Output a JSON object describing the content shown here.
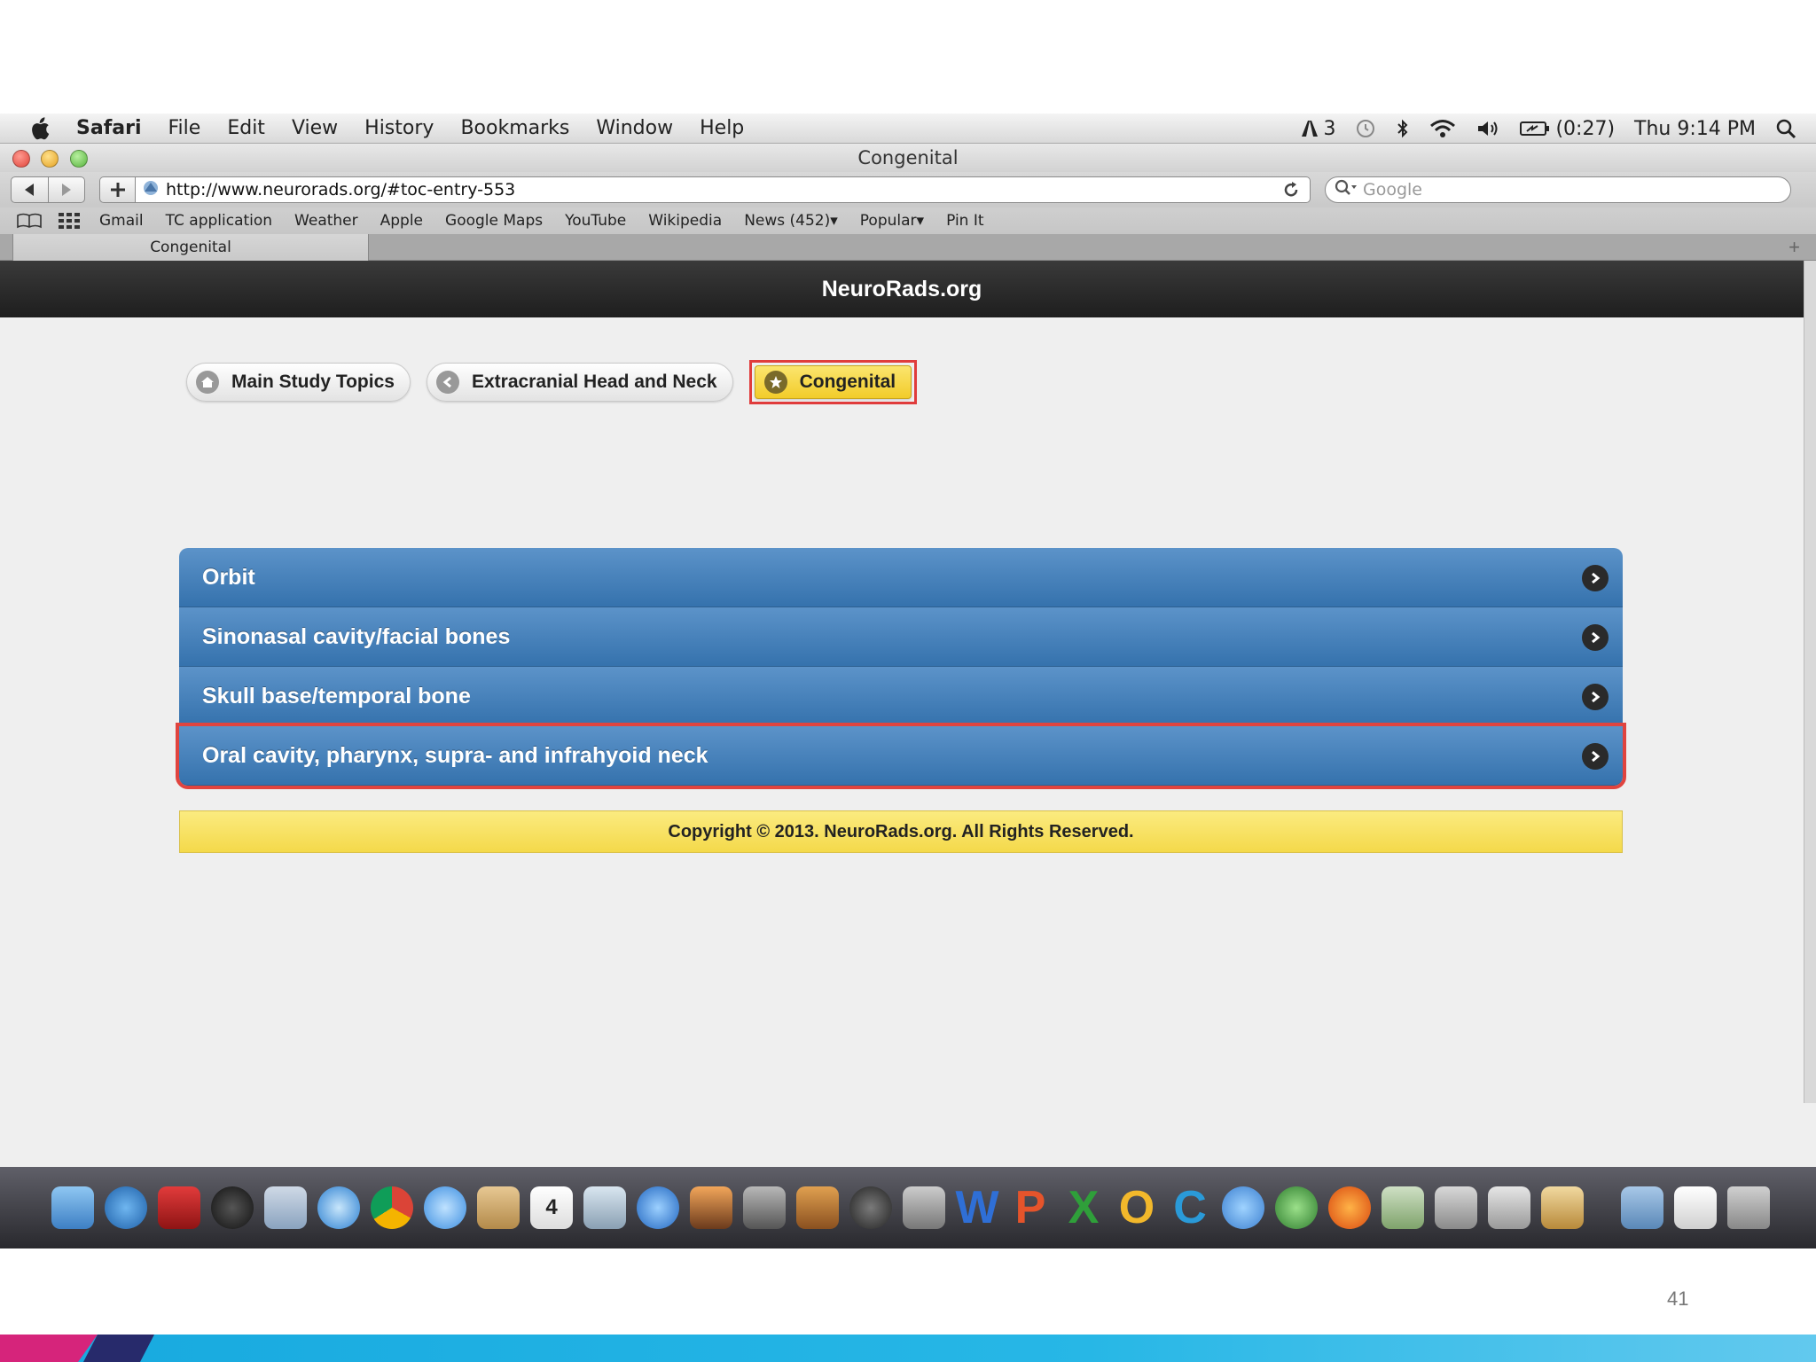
{
  "menubar": {
    "app_name": "Safari",
    "items": [
      "File",
      "Edit",
      "View",
      "History",
      "Bookmarks",
      "Window",
      "Help"
    ],
    "status": {
      "adobe_count": "3",
      "battery": "(0:27)",
      "clock": "Thu 9:14 PM"
    }
  },
  "window": {
    "title": "Congenital"
  },
  "toolbar": {
    "url": "http://www.neurorads.org/#toc-entry-553",
    "search_placeholder": "Google"
  },
  "bookmarks": [
    "Gmail",
    "TC application",
    "Weather",
    "Apple",
    "Google Maps",
    "YouTube",
    "Wikipedia",
    "News (452)▾",
    "Popular▾",
    "Pin It"
  ],
  "tab": {
    "label": "Congenital"
  },
  "site": {
    "title": "NeuroRads.org",
    "breadcrumbs": [
      {
        "label": "Main Study Topics",
        "icon": "home-icon"
      },
      {
        "label": "Extracranial Head and Neck",
        "icon": "back-icon"
      },
      {
        "label": "Congenital",
        "icon": "star-icon"
      }
    ],
    "list": [
      {
        "label": "Orbit",
        "highlighted": false
      },
      {
        "label": "Sinonasal cavity/facial bones",
        "highlighted": false
      },
      {
        "label": "Skull base/temporal bone",
        "highlighted": false
      },
      {
        "label": "Oral cavity, pharynx, supra- and infrahyoid neck",
        "highlighted": true
      }
    ],
    "copyright": "Copyright © 2013. NeuroRads.org. All Rights Reserved."
  },
  "slide": {
    "page_number": "41"
  },
  "colors": {
    "list_blue": "#3f7cb8",
    "highlight_red": "#e0443f",
    "active_crumb_yellow": "#f5d63a"
  }
}
